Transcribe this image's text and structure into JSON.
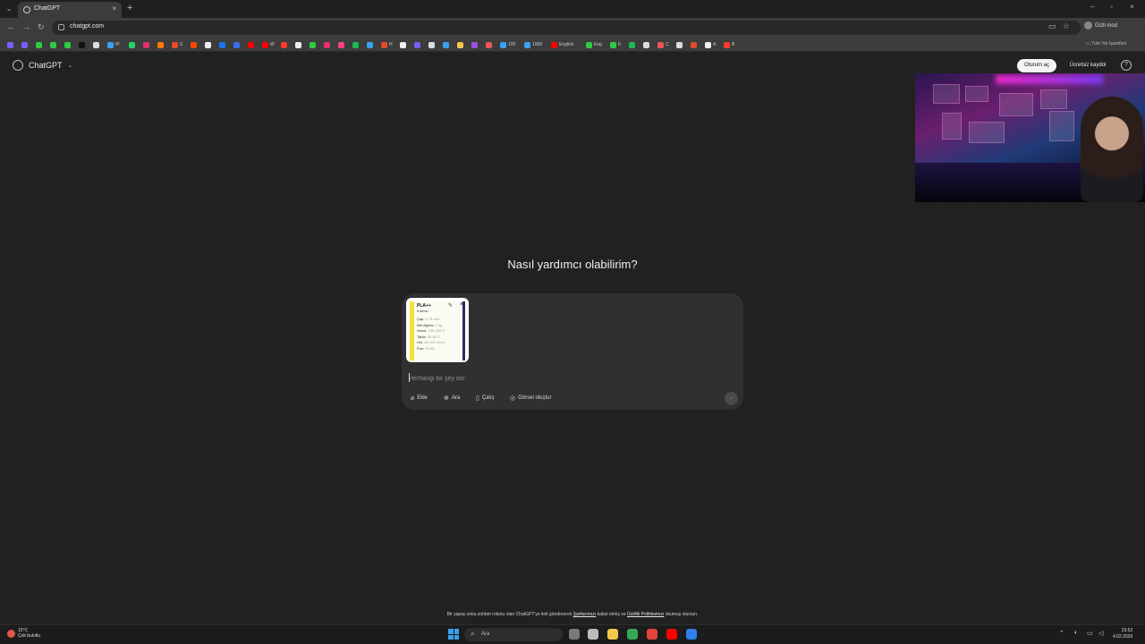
{
  "browser": {
    "tab_title": "ChatGPT",
    "url": "chatgpt.com",
    "incognito_label": "Gizli mod",
    "all_bookmarks_label": "Tüm Yer İşaretleri",
    "bookmarks": [
      {
        "label": "",
        "color": "#7b5cff"
      },
      {
        "label": "",
        "color": "#7b5cff"
      },
      {
        "label": "",
        "color": "#2ecc40"
      },
      {
        "label": "",
        "color": "#2ecc40"
      },
      {
        "label": "",
        "color": "#2ecc40"
      },
      {
        "label": "",
        "color": "#111111"
      },
      {
        "label": "",
        "color": "#dddddd"
      },
      {
        "label": "IP",
        "color": "#3aa0f0"
      },
      {
        "label": "",
        "color": "#25d366"
      },
      {
        "label": "",
        "color": "#e1306c"
      },
      {
        "label": "",
        "color": "#ff7a00"
      },
      {
        "label": "S",
        "color": "#e34c26"
      },
      {
        "label": "",
        "color": "#ff4500"
      },
      {
        "label": "",
        "color": "#eeeeee"
      },
      {
        "label": "",
        "color": "#1877f2"
      },
      {
        "label": "",
        "color": "#3a6ee8"
      },
      {
        "label": "",
        "color": "#ff0000"
      },
      {
        "label": "W",
        "color": "#ff0000"
      },
      {
        "label": "",
        "color": "#ff3b30"
      },
      {
        "label": "",
        "color": "#eeeeee"
      },
      {
        "label": "",
        "color": "#2ecc40"
      },
      {
        "label": "",
        "color": "#e1306c"
      },
      {
        "label": "",
        "color": "#ff4081"
      },
      {
        "label": "",
        "color": "#1db954"
      },
      {
        "label": "",
        "color": "#3aa0f0"
      },
      {
        "label": "H",
        "color": "#e34c26"
      },
      {
        "label": "",
        "color": "#eeeeee"
      },
      {
        "label": "",
        "color": "#7b5cff"
      },
      {
        "label": "",
        "color": "#dddddd"
      },
      {
        "label": "",
        "color": "#3aa0f0"
      },
      {
        "label": "",
        "color": "#f2c94c"
      },
      {
        "label": "",
        "color": "#9b51e0"
      },
      {
        "label": "",
        "color": "#eb5757"
      },
      {
        "label": "100",
        "color": "#3aa0f0"
      },
      {
        "label": "1000",
        "color": "#3aa0f0"
      },
      {
        "label": "English",
        "color": "#ff0000"
      },
      {
        "label": "Eng",
        "color": "#2ecc40"
      },
      {
        "label": "K",
        "color": "#2ecc40"
      },
      {
        "label": "",
        "color": "#1db954"
      },
      {
        "label": "",
        "color": "#dddddd"
      },
      {
        "label": "C",
        "color": "#eb5757"
      },
      {
        "label": "",
        "color": "#dddddd"
      },
      {
        "label": "",
        "color": "#e34c26"
      },
      {
        "label": "A",
        "color": "#eeeeee"
      },
      {
        "label": "B",
        "color": "#ff3b30"
      }
    ]
  },
  "header": {
    "brand": "ChatGPT",
    "login_label": "Oturum aç",
    "signup_label": "Ücretsiz kaydol",
    "help_label": "?"
  },
  "main": {
    "greeting": "Nasıl yardımcı olabilirim?"
  },
  "composer": {
    "placeholder": "Herhangi bir şey sor",
    "value": "",
    "attachment": {
      "title": "PLA++",
      "subtitle": "Kırmızı",
      "rows": [
        {
          "key": "Çap:",
          "val": "1.75 mm"
        },
        {
          "key": "Net Ağırlık:",
          "val": "1 kg"
        },
        {
          "key": "Nozul:",
          "val": "190-220°C"
        },
        {
          "key": "Tabla:",
          "val": "45-60°C"
        },
        {
          "key": "Hız:",
          "val": "40-100 mm/s"
        },
        {
          "key": "Fan:",
          "val": "%100"
        }
      ]
    },
    "tools": [
      {
        "icon": "paperclip-icon",
        "glyph": "⌀",
        "label": "Ekle"
      },
      {
        "icon": "globe-icon",
        "glyph": "⊕",
        "label": "Ara"
      },
      {
        "icon": "book-icon",
        "glyph": "▯",
        "label": "Çalış"
      },
      {
        "icon": "image-icon",
        "glyph": "◎",
        "label": "Görsel oluştur"
      }
    ],
    "send_glyph": "↑"
  },
  "footer": {
    "prefix": "Bir yapay zeka sohbet robotu olan ChatGPT'ye ileti göndererek ",
    "terms_link": "Şartlarımızı",
    "middle": " kabul etmiş ve ",
    "privacy_link": "Gizlilik Politikamızı",
    "suffix": " okumuş olursun."
  },
  "taskbar": {
    "weather_temp": "15°C",
    "weather_desc": "Çok bulutlu",
    "search_label": "Ara",
    "time": "23:52",
    "date": "4.02.2026",
    "apps": [
      {
        "name": "taskview-icon",
        "color": "#7a7a7a"
      },
      {
        "name": "settings-icon",
        "color": "#bbbbbb"
      },
      {
        "name": "file-explorer-icon",
        "color": "#f2c94c"
      },
      {
        "name": "chrome-icon",
        "color": "#34a853"
      },
      {
        "name": "app-red-icon",
        "color": "#e0443b"
      },
      {
        "name": "app-youtube-icon",
        "color": "#ff0000"
      },
      {
        "name": "app-blue-icon",
        "color": "#2f80ed"
      }
    ]
  }
}
